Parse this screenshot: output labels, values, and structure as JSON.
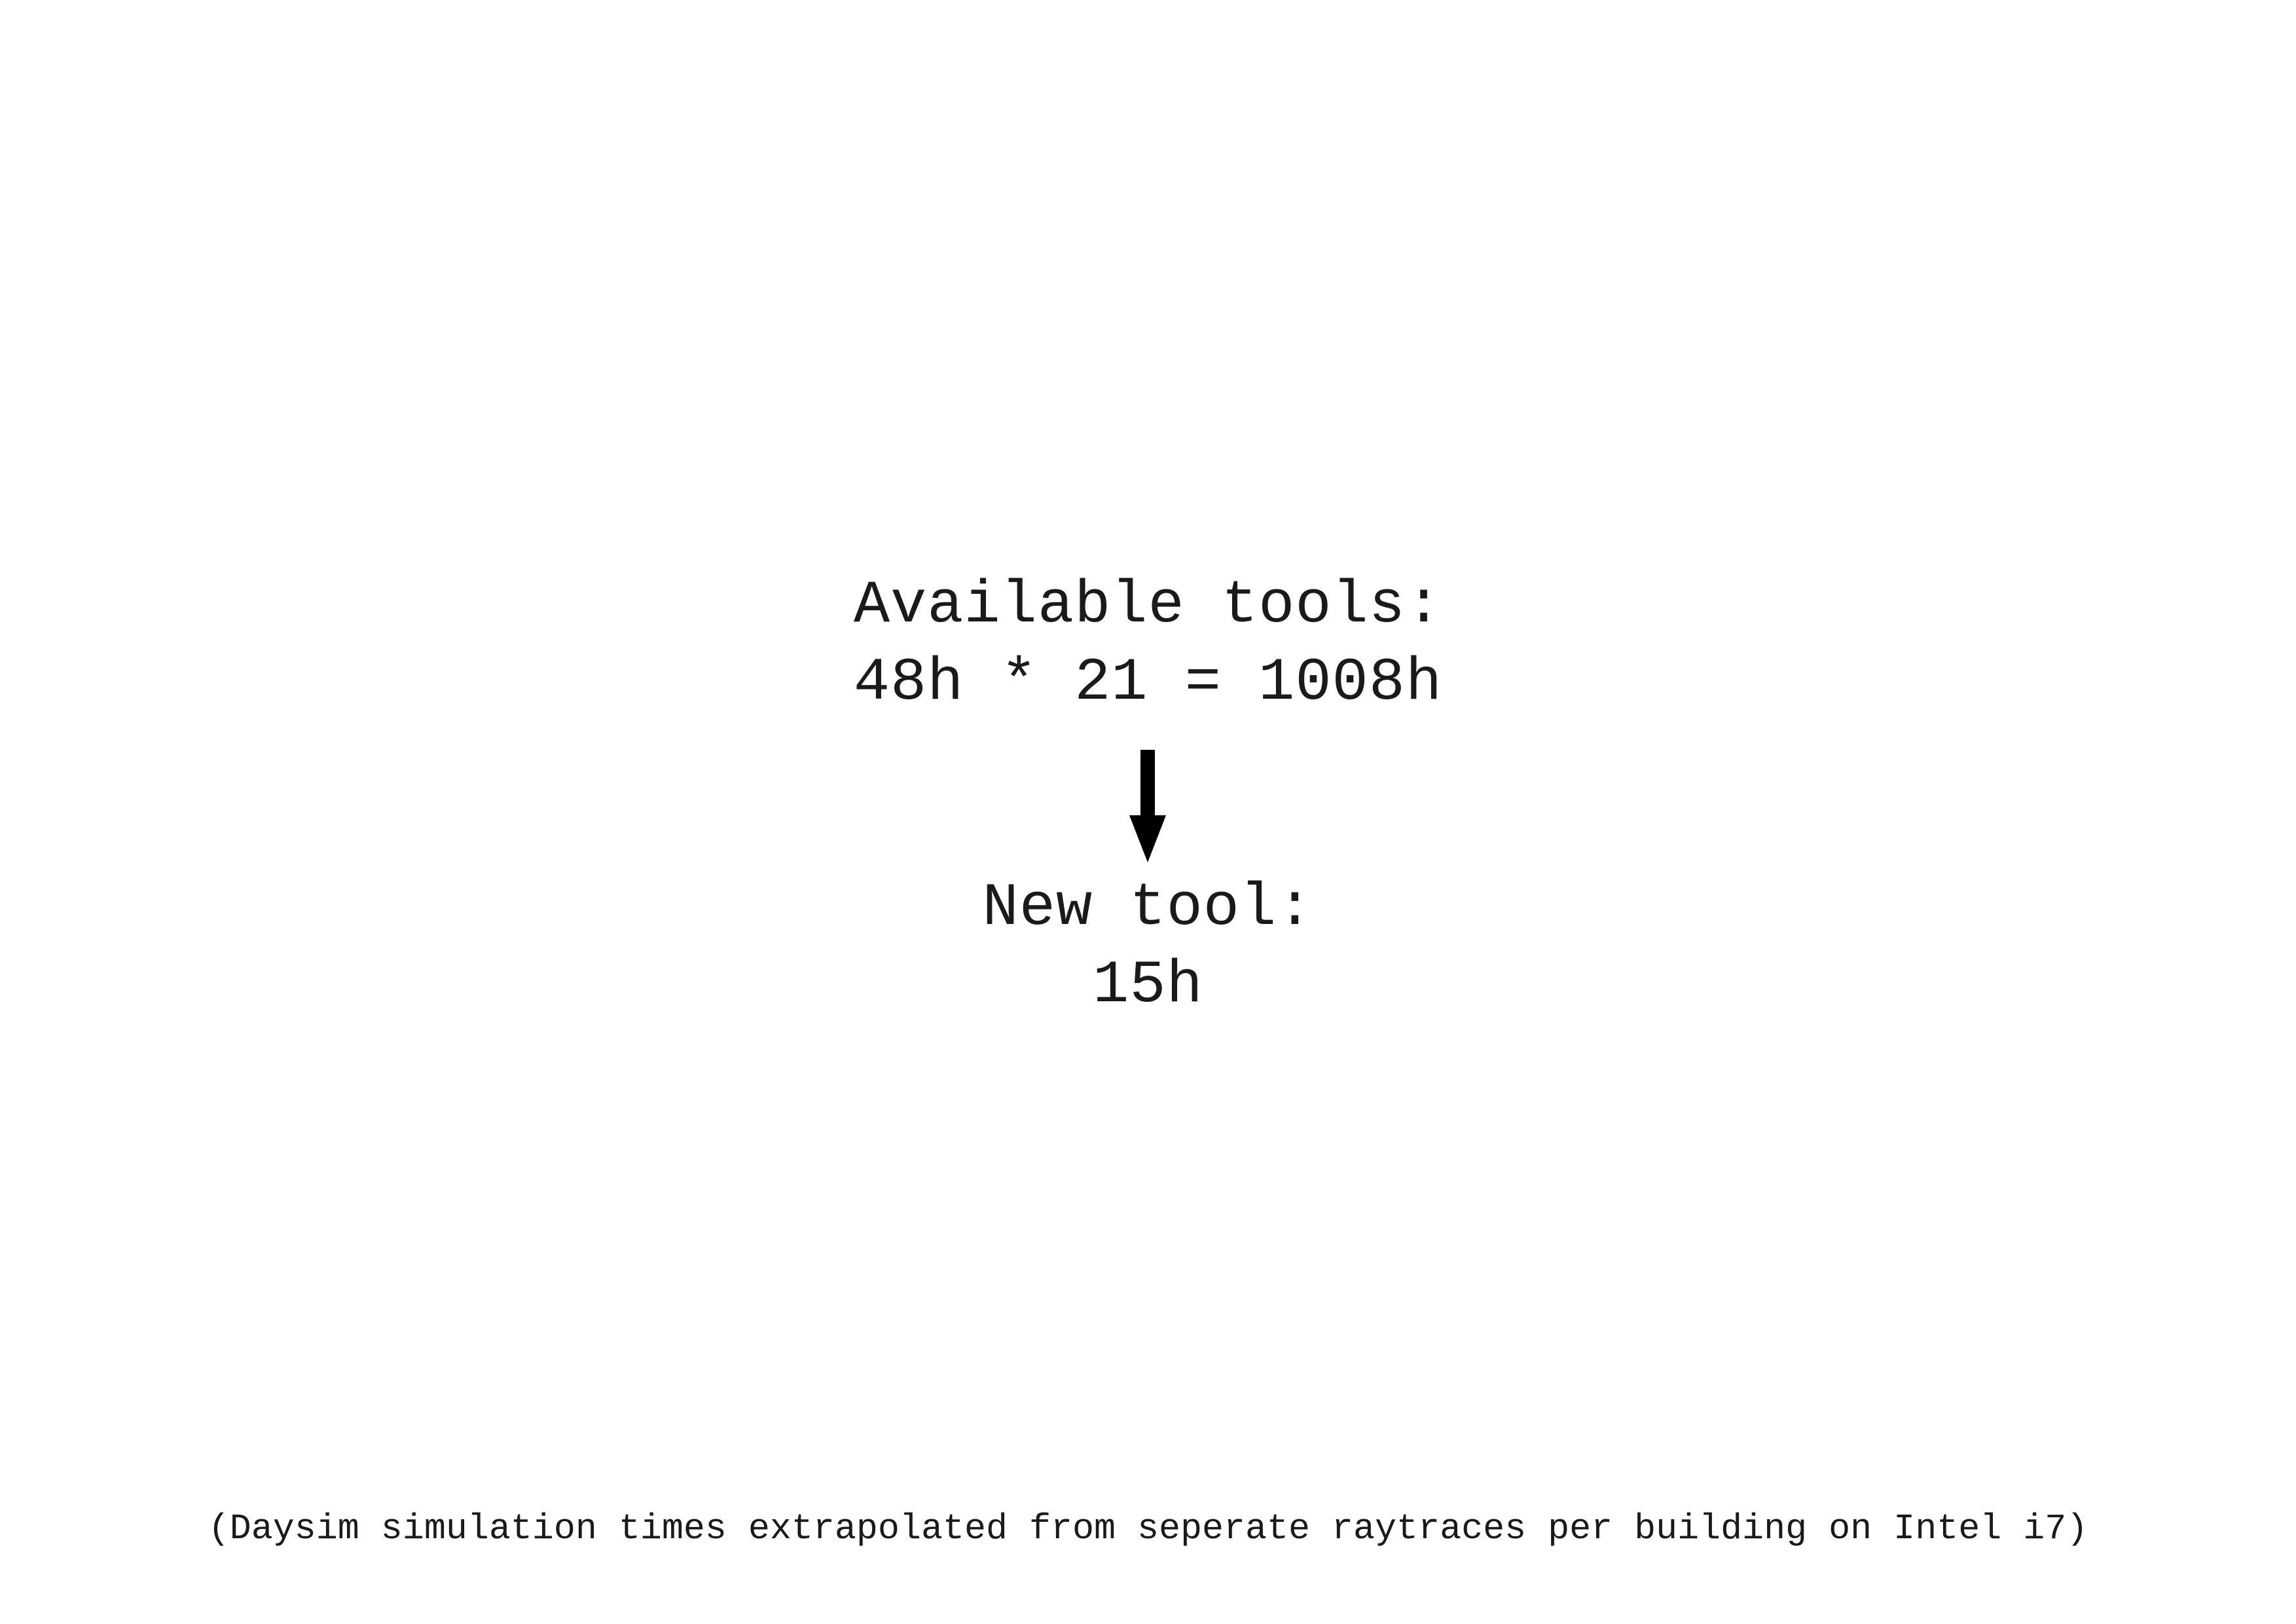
{
  "available": {
    "heading": "Available tools:",
    "formula": "48h * 21 = 1008h"
  },
  "new_tool": {
    "heading": "New tool:",
    "value": "15h"
  },
  "arrow_icon": "arrow-down-icon",
  "colors": {
    "text": "#1a1a1a",
    "arrow": "#000000",
    "background": "#ffffff"
  },
  "footnote": "(Daysim simulation times extrapolated from seperate raytraces per building on Intel i7)"
}
